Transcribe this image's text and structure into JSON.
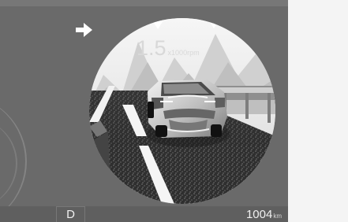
{
  "display": {
    "rpm": {
      "value": "1.5",
      "unit": "x1000rpm"
    },
    "gear": "D",
    "odometer": {
      "value": "1004",
      "unit": "km"
    },
    "direction_indicator": "right-arrow-icon"
  }
}
